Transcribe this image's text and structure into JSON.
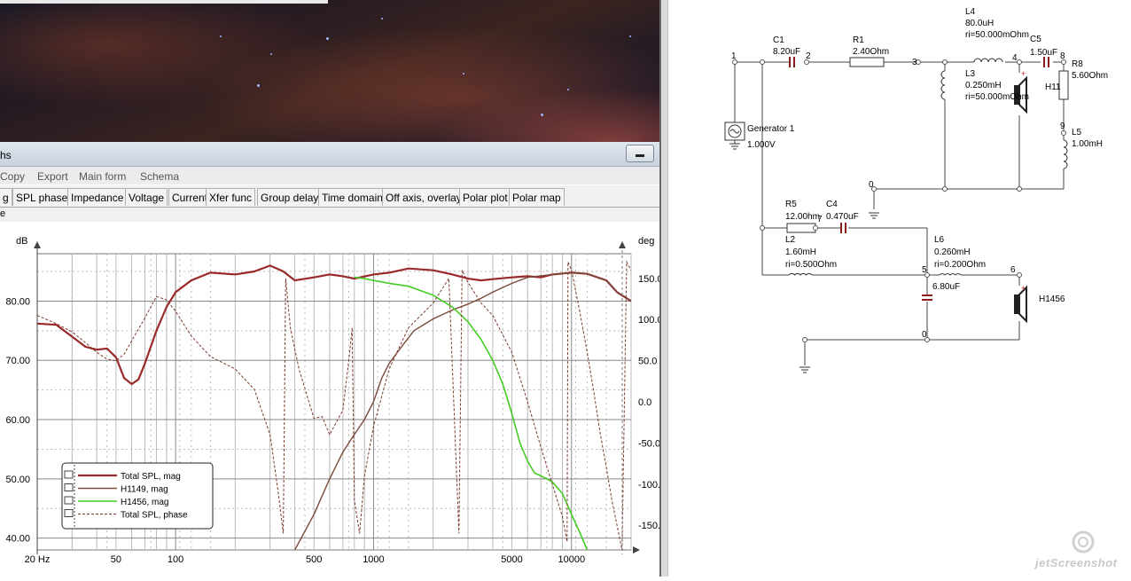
{
  "window": {
    "title_fragment": "hs",
    "minimize_glyph": "minimize-icon"
  },
  "menu": [
    "Copy",
    "Export",
    "Main form",
    "Schema"
  ],
  "tabs": [
    "g",
    "SPL phase",
    "Impedance",
    "Voltage",
    "Current",
    "Xfer func",
    "Group delay",
    "Time domain",
    "Off axis, overlay",
    "Polar plot",
    "Polar map"
  ],
  "subbar_label": "e",
  "chart_data": {
    "type": "line",
    "xscale": "log",
    "xlim": [
      20,
      20000
    ],
    "ylabel": "dB",
    "ylim": [
      38,
      88
    ],
    "ylabel_right": "deg",
    "ylim_right": [
      -180,
      180
    ],
    "x_ticks": [
      "20 Hz",
      "50",
      "100",
      "500",
      "1000",
      "5000",
      "10000"
    ],
    "x_tick_values": [
      20,
      50,
      100,
      500,
      1000,
      5000,
      10000
    ],
    "y_ticks": [
      "80.00",
      "70.00",
      "60.00",
      "50.00",
      "40.00"
    ],
    "y_tick_values": [
      80,
      70,
      60,
      50,
      40
    ],
    "y2_ticks": [
      "150.0",
      "100.0",
      "50.0",
      "0.0",
      "-50.0",
      "-100.0",
      "-150.0"
    ],
    "y2_tick_values": [
      150,
      100,
      50,
      0,
      -50,
      -100,
      -150
    ],
    "grid": true,
    "legend_position": "bottom-left",
    "series": [
      {
        "name": "Total SPL, mag",
        "color": "#9a2a2a",
        "axis": "left",
        "dash": false,
        "width": 2.2,
        "points": [
          [
            20,
            76.2
          ],
          [
            25,
            76
          ],
          [
            30,
            74
          ],
          [
            35,
            72.3
          ],
          [
            40,
            71.8
          ],
          [
            45,
            72
          ],
          [
            50,
            70.5
          ],
          [
            55,
            67
          ],
          [
            60,
            66
          ],
          [
            65,
            66.8
          ],
          [
            70,
            69.5
          ],
          [
            80,
            75
          ],
          [
            90,
            79
          ],
          [
            100,
            81.5
          ],
          [
            120,
            83.5
          ],
          [
            150,
            84.8
          ],
          [
            200,
            84.5
          ],
          [
            250,
            85
          ],
          [
            300,
            86
          ],
          [
            350,
            85
          ],
          [
            400,
            83.5
          ],
          [
            500,
            84
          ],
          [
            600,
            84.5
          ],
          [
            700,
            84.2
          ],
          [
            800,
            83.8
          ],
          [
            1000,
            84.5
          ],
          [
            1200,
            84.8
          ],
          [
            1500,
            85.5
          ],
          [
            2000,
            85.2
          ],
          [
            2500,
            84.5
          ],
          [
            3000,
            83.8
          ],
          [
            3500,
            83.5
          ],
          [
            4000,
            83.7
          ],
          [
            5000,
            84
          ],
          [
            6000,
            84.2
          ],
          [
            7000,
            84
          ],
          [
            8000,
            84.5
          ],
          [
            10000,
            84.8
          ],
          [
            12000,
            84.6
          ],
          [
            15000,
            83.5
          ],
          [
            17000,
            81.5
          ],
          [
            20000,
            80
          ]
        ]
      },
      {
        "name": "H1149, mag",
        "color": "#7a4a3a",
        "axis": "left",
        "dash": false,
        "width": 1.4,
        "points": [
          [
            400,
            38
          ],
          [
            500,
            44
          ],
          [
            600,
            50
          ],
          [
            700,
            54.5
          ],
          [
            800,
            57.5
          ],
          [
            900,
            60
          ],
          [
            1000,
            63
          ],
          [
            1100,
            67
          ],
          [
            1200,
            69.5
          ],
          [
            1400,
            72.5
          ],
          [
            1600,
            75
          ],
          [
            2000,
            77
          ],
          [
            2500,
            78.5
          ],
          [
            3000,
            79.5
          ],
          [
            3500,
            80.5
          ],
          [
            4000,
            81.5
          ],
          [
            5000,
            83
          ],
          [
            6000,
            84
          ],
          [
            8000,
            84.5
          ],
          [
            10000,
            84.8
          ],
          [
            12000,
            84.6
          ],
          [
            15000,
            83.5
          ],
          [
            17000,
            81.5
          ],
          [
            20000,
            80
          ]
        ]
      },
      {
        "name": "H1456, mag",
        "color": "#44cc22",
        "axis": "left",
        "dash": false,
        "width": 1.6,
        "points": [
          [
            800,
            84
          ],
          [
            900,
            83.8
          ],
          [
            1000,
            83.5
          ],
          [
            1200,
            83
          ],
          [
            1500,
            82.5
          ],
          [
            2000,
            81
          ],
          [
            2500,
            79
          ],
          [
            3000,
            76.5
          ],
          [
            3500,
            73.5
          ],
          [
            4000,
            70
          ],
          [
            4500,
            66
          ],
          [
            5000,
            61
          ],
          [
            5500,
            56
          ],
          [
            6000,
            53
          ],
          [
            6500,
            51
          ],
          [
            7000,
            50.5
          ],
          [
            8000,
            49.5
          ],
          [
            9000,
            47.5
          ],
          [
            10000,
            44
          ],
          [
            11000,
            41
          ],
          [
            12000,
            38
          ]
        ]
      },
      {
        "name": "Total SPL, phase",
        "color": "#7a3a2a",
        "axis": "right",
        "dash": true,
        "width": 1,
        "points": [
          [
            20,
            105
          ],
          [
            25,
            95
          ],
          [
            30,
            85
          ],
          [
            35,
            72
          ],
          [
            40,
            60
          ],
          [
            45,
            52
          ],
          [
            50,
            50
          ],
          [
            55,
            58
          ],
          [
            60,
            74
          ],
          [
            70,
            102
          ],
          [
            80,
            128
          ],
          [
            90,
            124
          ],
          [
            100,
            110
          ],
          [
            120,
            80
          ],
          [
            150,
            55
          ],
          [
            200,
            40
          ],
          [
            250,
            15
          ],
          [
            300,
            -40
          ],
          [
            330,
            -110
          ],
          [
            350,
            -160
          ],
          [
            360,
            150
          ],
          [
            380,
            90
          ],
          [
            420,
            40
          ],
          [
            500,
            -20
          ],
          [
            550,
            -18
          ],
          [
            600,
            -40
          ],
          [
            700,
            -10
          ],
          [
            750,
            50
          ],
          [
            780,
            90
          ],
          [
            800,
            -120
          ],
          [
            850,
            -160
          ],
          [
            900,
            -90
          ],
          [
            1000,
            -30
          ],
          [
            1200,
            40
          ],
          [
            1500,
            90
          ],
          [
            2000,
            120
          ],
          [
            2400,
            150
          ],
          [
            2700,
            -160
          ],
          [
            2800,
            160
          ],
          [
            3000,
            145
          ],
          [
            3500,
            120
          ],
          [
            4000,
            105
          ],
          [
            5000,
            60
          ],
          [
            6000,
            0
          ],
          [
            7000,
            -55
          ],
          [
            8000,
            -100
          ],
          [
            9000,
            -140
          ],
          [
            9500,
            -170
          ],
          [
            9600,
            170
          ],
          [
            10000,
            160
          ],
          [
            11000,
            110
          ],
          [
            12000,
            60
          ],
          [
            13000,
            10
          ],
          [
            14000,
            -40
          ],
          [
            15000,
            -80
          ],
          [
            16000,
            -120
          ],
          [
            18000,
            -180
          ],
          [
            19000,
            170
          ],
          [
            20000,
            160
          ]
        ]
      }
    ]
  },
  "schematic": {
    "components": {
      "C1": [
        "C1",
        "8.20uF"
      ],
      "R1": [
        "R1",
        "2.40Ohm"
      ],
      "L4": [
        "L4",
        "80.0uH",
        "ri=50.000mOhm"
      ],
      "C5": [
        "C5",
        "1.50uF"
      ],
      "R8": [
        "R8",
        "5.60Ohm"
      ],
      "L3": [
        "L3",
        "0.250mH",
        "ri=50.000mOhm"
      ],
      "H11": [
        "H11"
      ],
      "L5": [
        "L5",
        "1.00mH"
      ],
      "GEN": [
        "Generator 1",
        "1.000V"
      ],
      "R5": [
        "R5",
        "12.00hm"
      ],
      "C4": [
        "C4",
        "0.470uF"
      ],
      "L2": [
        "L2",
        "1.60mH",
        "ri=0.500Ohm"
      ],
      "L6": [
        "L6",
        "0.260mH",
        "ri=0.200Ohm"
      ],
      "C6": [
        "6.80uF"
      ],
      "H1456": [
        "H1456"
      ]
    },
    "nodes": [
      "1",
      "2",
      "3",
      "4",
      "8",
      "9",
      "0",
      "7",
      "5",
      "6",
      "0"
    ]
  },
  "watermark": "jetScreenshot"
}
